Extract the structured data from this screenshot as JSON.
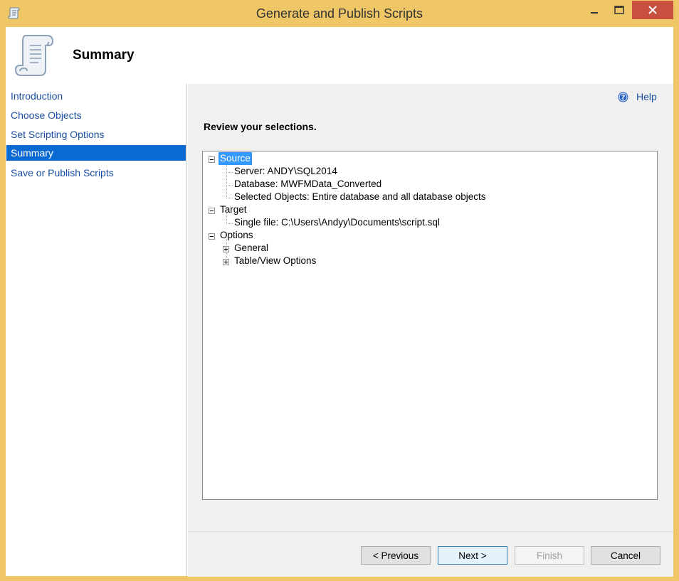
{
  "window": {
    "title": "Generate and Publish Scripts",
    "accent_color": "#f0c766",
    "close_color": "#c7503f"
  },
  "header": {
    "title": "Summary",
    "icon": "scroll-icon"
  },
  "nav": {
    "items": [
      {
        "label": "Introduction"
      },
      {
        "label": "Choose Objects"
      },
      {
        "label": "Set Scripting Options"
      },
      {
        "label": "Summary",
        "selected": true
      },
      {
        "label": "Save or Publish Scripts"
      }
    ],
    "selected_color": "#0a6ad1",
    "link_color": "#1a4ea2"
  },
  "main": {
    "help_label": "Help",
    "instruction": "Review your selections.",
    "tree": {
      "source": {
        "label": "Source",
        "server": "Server: ANDY\\SQL2014",
        "database": "Database: MWFMData_Converted",
        "selected_objects": "Selected Objects: Entire database and all database objects"
      },
      "target": {
        "label": "Target",
        "single_file": "Single file: C:\\Users\\Andyy\\Documents\\script.sql"
      },
      "options": {
        "label": "Options",
        "general": "General",
        "table_view": "Table/View Options"
      }
    }
  },
  "buttons": {
    "previous": "< Previous",
    "next": "Next >",
    "finish": "Finish",
    "cancel": "Cancel"
  }
}
